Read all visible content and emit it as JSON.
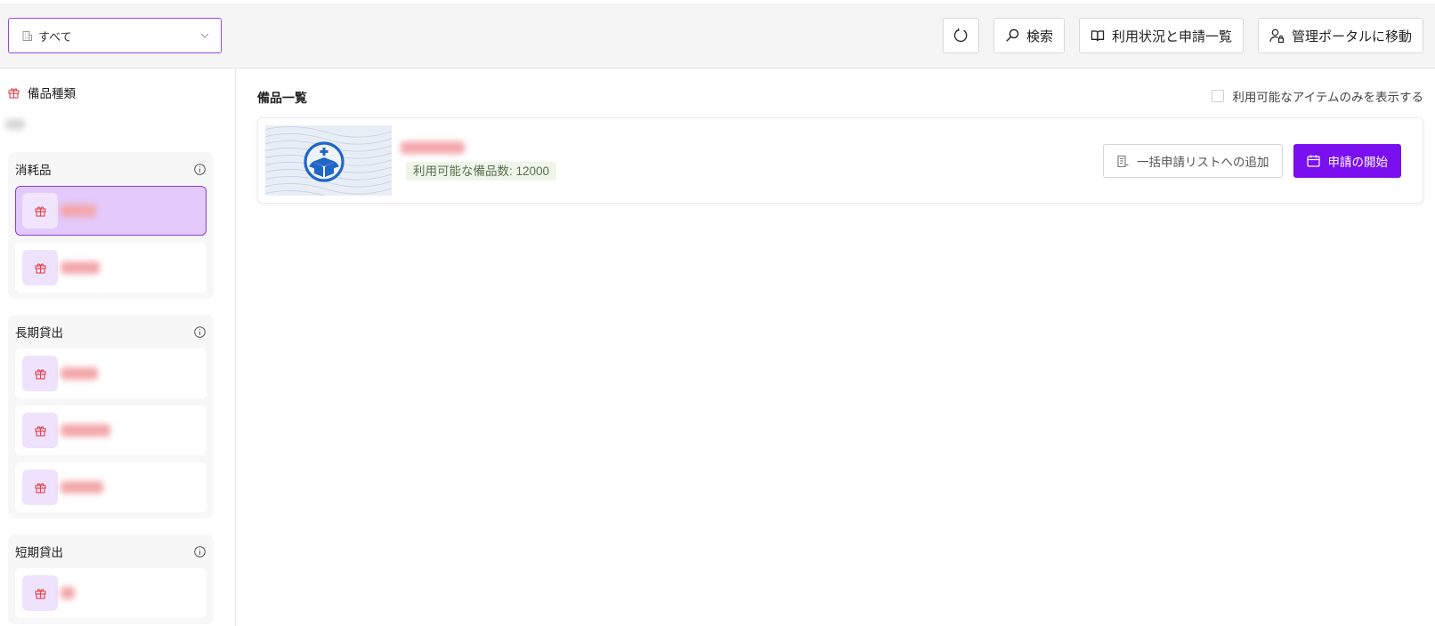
{
  "theme": {
    "accent": "#7a0ff0",
    "accent_border": "#9b45e8",
    "selected_bg": "#e4c9fc",
    "icon_red": "#e0474c",
    "tile_bg": "#efe2fc",
    "badge_bg": "#eef6e9",
    "badge_text": "#5b6f50"
  },
  "header": {
    "location_select": {
      "value": "すべて",
      "icon": "building-icon",
      "chevron": "chevron-down-icon"
    },
    "refresh_button": {
      "icon": "refresh-icon"
    },
    "search_button": {
      "label": "検索",
      "icon": "search-icon"
    },
    "usage_button": {
      "label": "利用状況と申請一覧",
      "icon": "book-icon"
    },
    "admin_button": {
      "label": "管理ポータルに移動",
      "icon": "user-lock-icon"
    }
  },
  "sidebar": {
    "title": "備品種類",
    "title_icon": "gift-icon",
    "groups": [
      {
        "label": "消耗品",
        "info_icon": "info-icon",
        "items": [
          {
            "icon": "gift-icon",
            "selected": true
          },
          {
            "icon": "gift-icon",
            "selected": false
          }
        ]
      },
      {
        "label": "長期貸出",
        "info_icon": "info-icon",
        "items": [
          {
            "icon": "gift-icon",
            "selected": false
          },
          {
            "icon": "gift-icon",
            "selected": false
          },
          {
            "icon": "gift-icon",
            "selected": false
          }
        ]
      },
      {
        "label": "短期貸出",
        "info_icon": "info-icon",
        "items": [
          {
            "icon": "gift-icon",
            "selected": false
          }
        ]
      }
    ]
  },
  "main": {
    "title": "備品一覧",
    "filter": {
      "label": "利用可能なアイテムのみを表示する",
      "checked": false
    },
    "equipment": [
      {
        "thumbnail_icon": "box-plus-icon",
        "availability": "利用可能な備品数: 12000",
        "add_to_bulk_label": "一括申請リストへの追加",
        "add_icon": "list-icon",
        "start_request_label": "申請の開始",
        "start_icon": "calendar-icon"
      }
    ]
  }
}
